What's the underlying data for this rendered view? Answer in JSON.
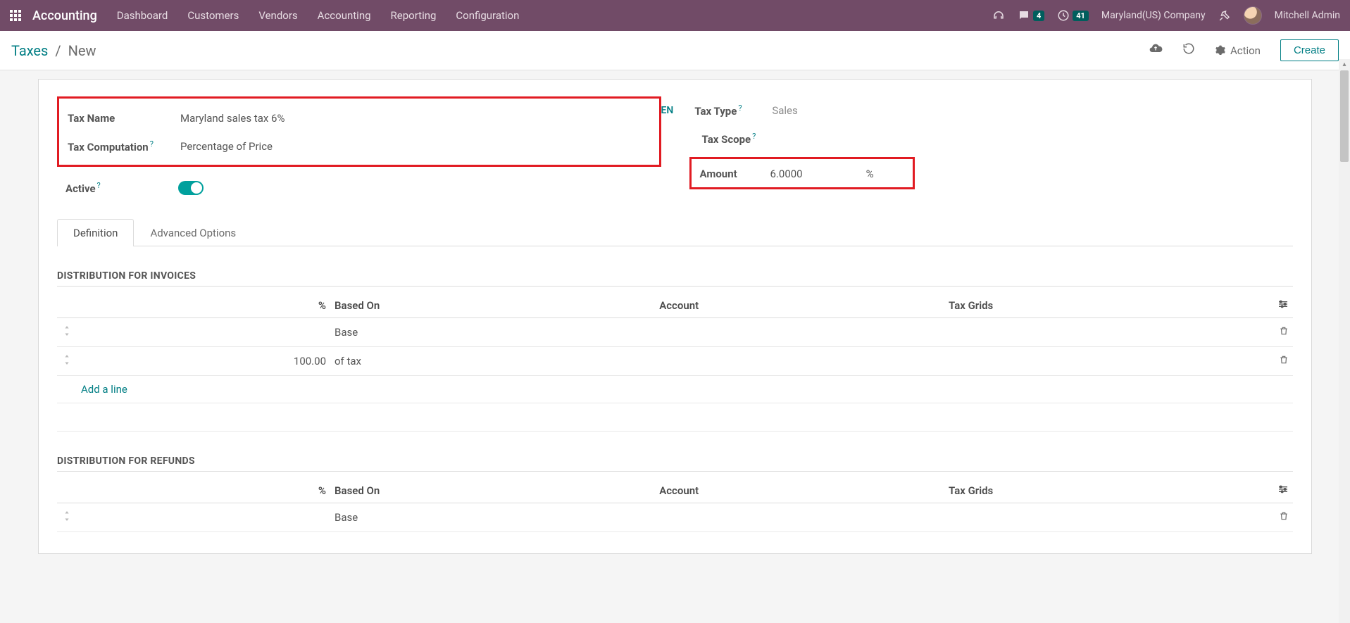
{
  "navbar": {
    "brand": "Accounting",
    "menu": [
      "Dashboard",
      "Customers",
      "Vendors",
      "Accounting",
      "Reporting",
      "Configuration"
    ],
    "chat_badge": "4",
    "clock_badge": "41",
    "company": "Maryland(US) Company",
    "user": "Mitchell Admin"
  },
  "breadcrumb": {
    "parent": "Taxes",
    "current": "New"
  },
  "actions": {
    "action_label": "Action",
    "create_label": "Create"
  },
  "form": {
    "tax_name_label": "Tax Name",
    "tax_name_value": "Maryland sales tax 6%",
    "tax_computation_label": "Tax Computation",
    "tax_computation_value": "Percentage of Price",
    "active_label": "Active",
    "lang": "EN",
    "tax_type_label": "Tax Type",
    "tax_type_value": "Sales",
    "tax_scope_label": "Tax Scope",
    "amount_label": "Amount",
    "amount_value": "6.0000",
    "amount_unit": "%"
  },
  "tabs": {
    "definition": "Definition",
    "advanced": "Advanced Options"
  },
  "dist_invoices_title": "Distribution for Invoices",
  "dist_refunds_title": "Distribution for Refunds",
  "columns": {
    "pct": "%",
    "based_on": "Based On",
    "account": "Account",
    "tax_grids": "Tax Grids"
  },
  "invoice_rows": [
    {
      "pct": "",
      "based_on": "Base"
    },
    {
      "pct": "100.00",
      "based_on": "of tax"
    }
  ],
  "refund_rows": [
    {
      "pct": "",
      "based_on": "Base"
    }
  ],
  "add_line": "Add a line"
}
